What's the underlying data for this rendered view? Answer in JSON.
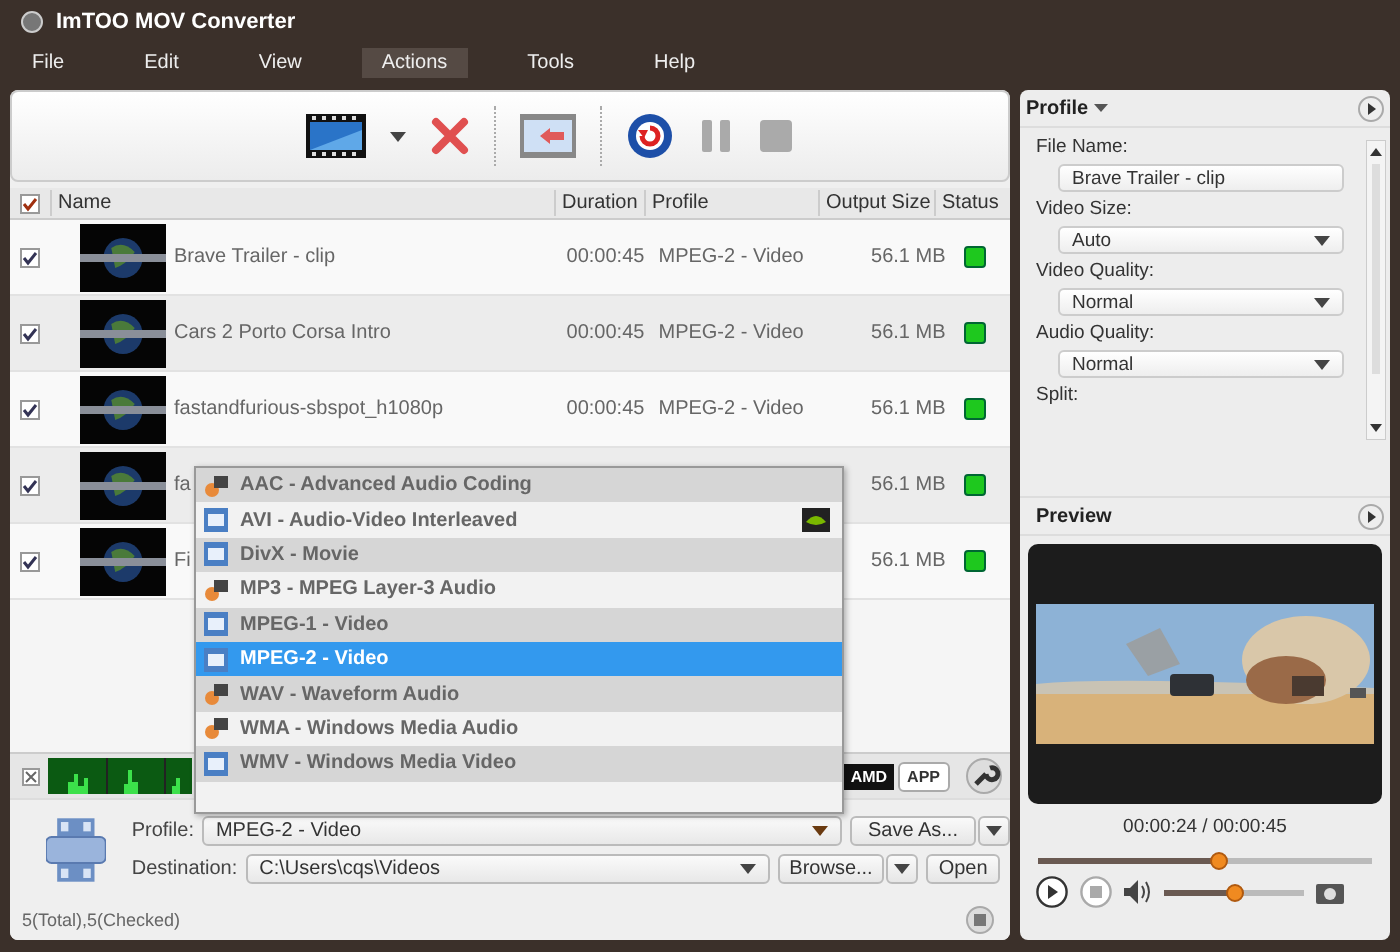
{
  "window": {
    "title": "ImTOO MOV Converter"
  },
  "menu": [
    {
      "label": "File",
      "selected": false
    },
    {
      "label": "Edit",
      "selected": false
    },
    {
      "label": "View",
      "selected": false
    },
    {
      "label": "Actions",
      "selected": true
    },
    {
      "label": "Tools",
      "selected": false
    },
    {
      "label": "Help",
      "selected": false
    }
  ],
  "table": {
    "all_checked": true,
    "columns": [
      "Name",
      "Duration",
      "Profile",
      "Output Size",
      "Status"
    ],
    "rows": [
      {
        "checked": true,
        "name": "Brave Trailer - clip",
        "duration": "00:00:45",
        "profile": "MPEG-2 - Video",
        "size": "56.1 MB"
      },
      {
        "checked": true,
        "name": "Cars 2 Porto Corsa Intro",
        "duration": "00:00:45",
        "profile": "MPEG-2 - Video",
        "size": "56.1 MB"
      },
      {
        "checked": true,
        "name": "fastandfurious-sbspot_h1080p",
        "duration": "00:00:45",
        "profile": "MPEG-2 - Video",
        "size": "56.1 MB"
      },
      {
        "checked": true,
        "name": "fa",
        "size": "56.1 MB"
      },
      {
        "checked": true,
        "name": "Fi",
        "size": "56.1 MB"
      }
    ]
  },
  "profile_dropdown": {
    "items": [
      {
        "label": "AAC - Advanced Audio Coding",
        "kind": "audio",
        "accelerated": false,
        "selected": false
      },
      {
        "label": "AVI - Audio-Video Interleaved",
        "kind": "video",
        "accelerated": true,
        "selected": false
      },
      {
        "label": "DivX - Movie",
        "kind": "video",
        "accelerated": false,
        "selected": false
      },
      {
        "label": "MP3 - MPEG Layer-3 Audio",
        "kind": "audio",
        "accelerated": false,
        "selected": false
      },
      {
        "label": "MPEG-1 - Video",
        "kind": "video",
        "accelerated": false,
        "selected": false
      },
      {
        "label": "MPEG-2 - Video",
        "kind": "video",
        "accelerated": false,
        "selected": true
      },
      {
        "label": "WAV - Waveform Audio",
        "kind": "audio",
        "accelerated": false,
        "selected": false
      },
      {
        "label": "WMA - Windows Media Audio",
        "kind": "audio",
        "accelerated": false,
        "selected": false
      },
      {
        "label": "WMV - Windows Media Video",
        "kind": "video",
        "accelerated": false,
        "selected": false
      }
    ]
  },
  "badges": [
    "AMD",
    "APP"
  ],
  "output": {
    "profile_label": "Profile:",
    "profile_value": "MPEG-2 - Video",
    "save_as": "Save As...",
    "destination_label": "Destination:",
    "destination_value": "C:\\Users\\cqs\\Videos",
    "browse": "Browse...",
    "open": "Open"
  },
  "status_bar": "5(Total),5(Checked)",
  "side_panel": {
    "title": "Profile",
    "fields": [
      {
        "label": "File Name:",
        "value": "Brave Trailer - clip",
        "kind": "text"
      },
      {
        "label": "Video Size:",
        "value": "Auto",
        "kind": "select"
      },
      {
        "label": "Video Quality:",
        "value": "Normal",
        "kind": "select"
      },
      {
        "label": "Audio Quality:",
        "value": "Normal",
        "kind": "select"
      },
      {
        "label": "Split:",
        "kind": "label"
      }
    ]
  },
  "preview": {
    "title": "Preview",
    "time": "00:00:24 / 00:00:45",
    "position": {
      "level": 0.54
    },
    "volume": {
      "level": 0.5
    }
  }
}
